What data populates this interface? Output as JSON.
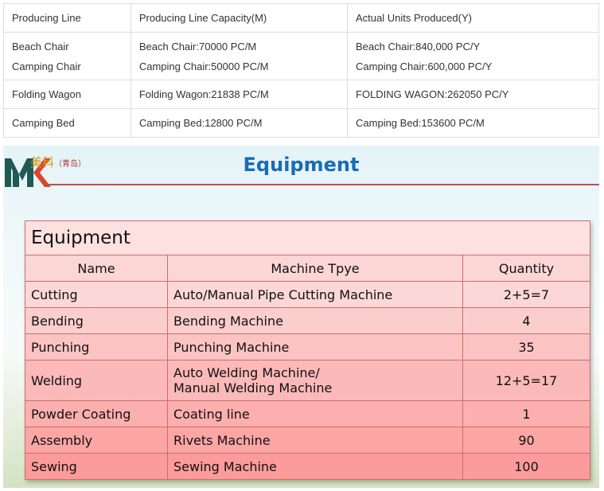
{
  "capacity_table": {
    "headers": [
      "Producing Line",
      "Producing Line Capacity(M)",
      "Actual Units Produced(Y)"
    ],
    "rows": [
      {
        "line": [
          "Beach Chair",
          "Camping Chair"
        ],
        "capacity": [
          "Beach Chair:70000 PC/M",
          "Camping Chair:50000 PC/M"
        ],
        "actual": [
          "Beach Chair:840,000 PC/Y",
          "Camping Chair:600,000 PC/Y"
        ]
      },
      {
        "line": [
          "Folding Wagon"
        ],
        "capacity": [
          "Folding Wagon:21838 PC/M"
        ],
        "actual": [
          "FOLDING WAGON:262050 PC/Y"
        ]
      },
      {
        "line": [
          "Camping Bed"
        ],
        "capacity": [
          "Camping Bed:12800 PC/M"
        ],
        "actual": [
          "Camping Bed:153600 PC/M"
        ]
      }
    ]
  },
  "slide": {
    "logo_text": "美科",
    "logo_sub": "（青岛）",
    "title": "Equipment",
    "title_color": "#1a6bb3",
    "table": {
      "caption": "Equipment",
      "headers": [
        "Name",
        "Machine Tpye",
        "Quantity"
      ],
      "rows": [
        {
          "name": "Cutting",
          "machine": [
            "Auto/Manual Pipe Cutting Machine"
          ],
          "qty": "2+5=7"
        },
        {
          "name": "Bending",
          "machine": [
            "Bending Machine"
          ],
          "qty": "4"
        },
        {
          "name": "Punching",
          "machine": [
            "Punching Machine"
          ],
          "qty": "35"
        },
        {
          "name": "Welding",
          "machine": [
            "Auto Welding Machine/",
            "Manual Welding Machine"
          ],
          "qty": "12+5=17"
        },
        {
          "name": "Powder Coating",
          "machine": [
            "Coating line"
          ],
          "qty": "1"
        },
        {
          "name": "Assembly",
          "machine": [
            "Rivets Machine"
          ],
          "qty": "90"
        },
        {
          "name": "Sewing",
          "machine": [
            "Sewing Machine"
          ],
          "qty": "100"
        }
      ]
    }
  }
}
